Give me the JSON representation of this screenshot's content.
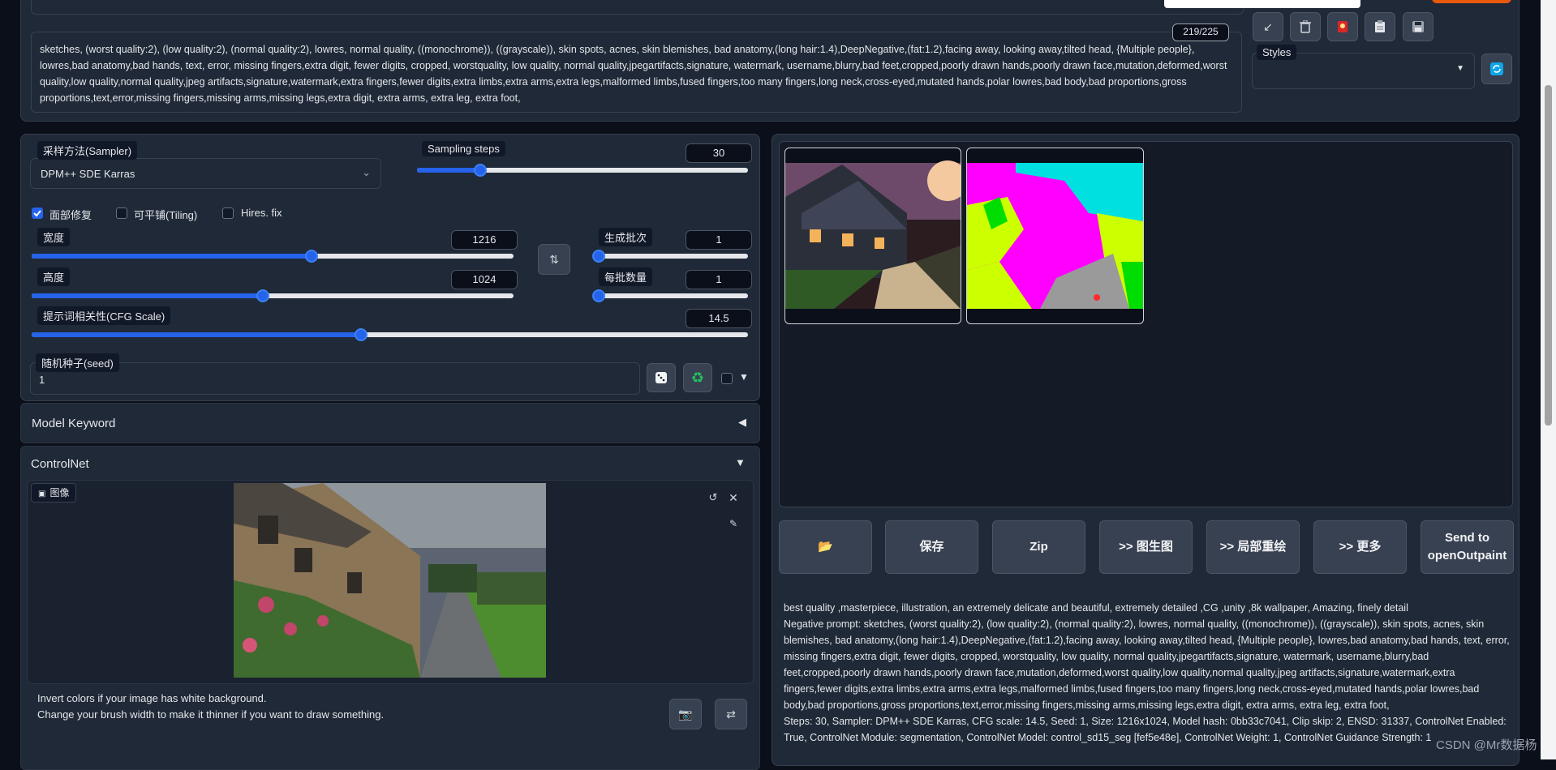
{
  "negative_prompt": {
    "text": "sketches, (worst quality:2), (low quality:2), (normal quality:2), lowres, normal quality, ((monochrome)), ((grayscale)), skin spots, acnes, skin blemishes, bad anatomy,(long hair:1.4),DeepNegative,(fat:1.2),facing away, looking away,tilted head, {Multiple people}, lowres,bad anatomy,bad hands, text, error, missing fingers,extra digit, fewer digits, cropped, worstquality, low quality, normal quality,jpegartifacts,signature, watermark, username,blurry,bad feet,cropped,poorly drawn hands,poorly drawn face,mutation,deformed,worst quality,low quality,normal quality,jpeg artifacts,signature,watermark,extra fingers,fewer digits,extra limbs,extra arms,extra legs,malformed limbs,fused fingers,too many fingers,long neck,cross-eyed,mutated hands,polar lowres,bad body,bad proportions,gross proportions,text,error,missing fingers,missing arms,missing legs,extra digit, extra arms, extra leg, extra foot,",
    "token_count": "219/225"
  },
  "toolbar_icons": [
    "arrow-icon",
    "trash-icon",
    "style-icon",
    "clipboard-icon",
    "save-icon"
  ],
  "styles": {
    "label": "Styles",
    "selected": ""
  },
  "sampler": {
    "label": "采样方法(Sampler)",
    "value": "DPM++ SDE Karras"
  },
  "sampling_steps": {
    "label": "Sampling steps",
    "value": "30",
    "fraction": 0.19
  },
  "checkboxes": [
    {
      "label": "面部修复",
      "checked": true
    },
    {
      "label": "可平铺(Tiling)",
      "checked": false
    },
    {
      "label": "Hires. fix",
      "checked": false
    }
  ],
  "width": {
    "label": "宽度",
    "value": "1216",
    "fraction": 0.58
  },
  "height": {
    "label": "高度",
    "value": "1024",
    "fraction": 0.48
  },
  "batch_count": {
    "label": "生成批次",
    "value": "1",
    "fraction": 0.0
  },
  "batch_size": {
    "label": "每批数量",
    "value": "1",
    "fraction": 0.0
  },
  "cfg_scale": {
    "label": "提示词相关性(CFG Scale)",
    "value": "14.5",
    "fraction": 0.46
  },
  "seed": {
    "label": "随机种子(seed)",
    "value": "1"
  },
  "model_keyword": {
    "label": "Model Keyword"
  },
  "controlnet": {
    "label": "ControlNet",
    "image_tab": "图像",
    "hint_line1": "Invert colors if your image has white background.",
    "hint_line2": "Change your brush width to make it thinner if you want to draw something."
  },
  "output_buttons": {
    "folder": "📂",
    "save": "保存",
    "zip": "Zip",
    "img2img": ">> 图生图",
    "inpaint": ">> 局部重绘",
    "extras": ">> 更多",
    "outpaint": "Send to openOutpaint"
  },
  "generation_info": {
    "prompt": "best quality ,masterpiece, illustration, an extremely delicate and beautiful, extremely detailed ,CG ,unity ,8k wallpaper, Amazing, finely detail",
    "negative": "Negative prompt: sketches, (worst quality:2), (low quality:2), (normal quality:2), lowres, normal quality, ((monochrome)), ((grayscale)), skin spots, acnes, skin blemishes, bad anatomy,(long hair:1.4),DeepNegative,(fat:1.2),facing away, looking away,tilted head, {Multiple people}, lowres,bad anatomy,bad hands, text, error, missing fingers,extra digit, fewer digits, cropped, worstquality, low quality, normal quality,jpegartifacts,signature, watermark, username,blurry,bad feet,cropped,poorly drawn hands,poorly drawn face,mutation,deformed,worst quality,low quality,normal quality,jpeg artifacts,signature,watermark,extra fingers,fewer digits,extra limbs,extra arms,extra legs,malformed limbs,fused fingers,too many fingers,long neck,cross-eyed,mutated hands,polar lowres,bad body,bad proportions,gross proportions,text,error,missing fingers,missing arms,missing legs,extra digit, extra arms, extra leg, extra foot,",
    "params": "Steps: 30, Sampler: DPM++ SDE Karras, CFG scale: 14.5, Seed: 1, Size: 1216x1024, Model hash: 0bb33c7041, Clip skip: 2, ENSD: 31337, ControlNet Enabled: True, ControlNet Module: segmentation, ControlNet Model: control_sd15_seg [fef5e48e], ControlNet Weight: 1, ControlNet Guidance Strength: 1"
  },
  "watermark": "CSDN @Mr数据杨"
}
